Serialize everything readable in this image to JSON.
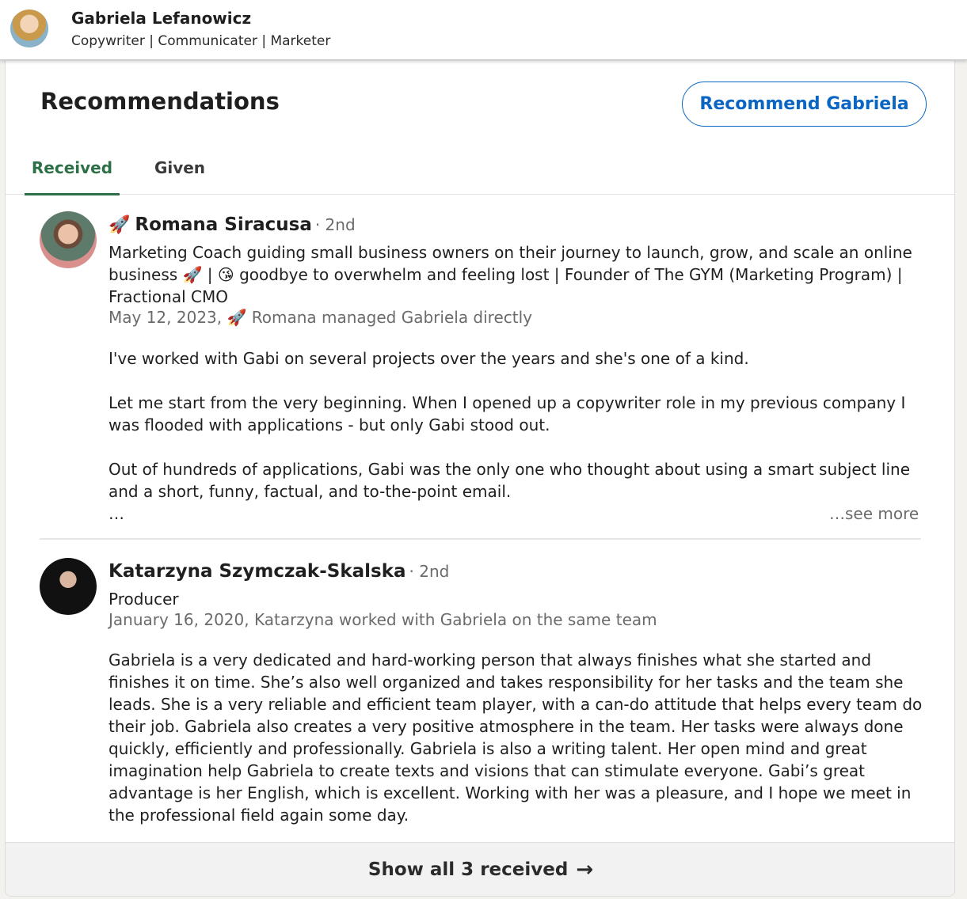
{
  "profile": {
    "name": "Gabriela Lefanowicz",
    "headline": "Copywriter | Communicater | Marketer"
  },
  "section": {
    "title": "Recommendations",
    "recommend_button": "Recommend Gabriela"
  },
  "tabs": [
    {
      "label": "Received",
      "active": true
    },
    {
      "label": "Given",
      "active": false
    }
  ],
  "recommendations": [
    {
      "name": "Romana Siracusa",
      "name_prefix_emoji": "🚀",
      "degree": "· 2nd",
      "title": "Marketing Coach guiding small business owners on their journey to launch, grow, and scale an online business 🚀 | 😘 goodbye to overwhelm and feeling lost | Founder of The GYM (Marketing Program) | Fractional CMO",
      "meta": "May 12, 2023, 🚀 Romana managed Gabriela directly",
      "paragraphs": [
        "I've worked with Gabi on several projects over the years and she's one of a kind.",
        "Let me start from the very beginning. When I opened up a copywriter role in my previous company I was flooded with applications - but only Gabi stood out.",
        "Out of hundreds of applications, Gabi was the only one who thought about using a smart subject line and a short, funny, factual, and to-the-point email.\n…"
      ],
      "see_more": "…see more"
    },
    {
      "name": "Katarzyna Szymczak-Skalska",
      "degree": "· 2nd",
      "title": "Producer",
      "meta": "January 16, 2020, Katarzyna worked with Gabriela on the same team",
      "paragraphs": [
        "Gabriela is a very dedicated and hard-working person that always finishes what she started and finishes it on time. She’s also well organized and takes responsibility for her tasks and the team she leads. She is a very reliable and efficient team player, with a can-do attitude that helps every team do their job. Gabriela also creates a very positive atmosphere in the team. Her tasks were always done quickly, efficiently and professionally. Gabriela is also a writing talent. Her open mind and great imagination help Gabriela to create texts and visions that can stimulate everyone. Gabi’s great advantage is her English, which is excellent. Working with her was a pleasure, and I hope we meet in the professional field again some day."
      ]
    }
  ],
  "footer": {
    "label": "Show all 3 received",
    "arrow_icon": "→"
  }
}
